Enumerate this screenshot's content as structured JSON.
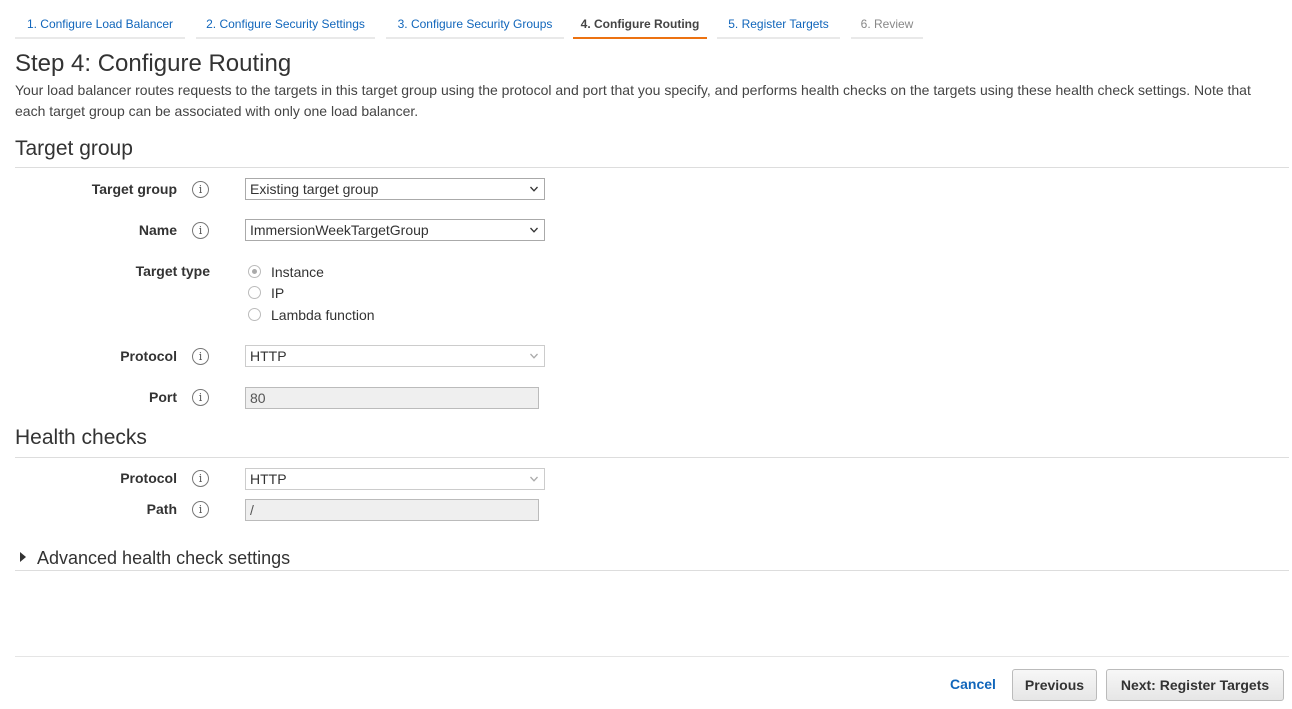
{
  "wizard": {
    "steps": [
      {
        "label": "1. Configure Load Balancer",
        "state": "done"
      },
      {
        "label": "2. Configure Security Settings",
        "state": "done"
      },
      {
        "label": "3. Configure Security Groups",
        "state": "done"
      },
      {
        "label": "4. Configure Routing",
        "state": "active"
      },
      {
        "label": "5. Register Targets",
        "state": "link"
      },
      {
        "label": "6. Review",
        "state": "disabled"
      }
    ],
    "accent_color": "#ec7211",
    "link_color": "#1166bb"
  },
  "page": {
    "title": "Step 4: Configure Routing",
    "description": "Your load balancer routes requests to the targets in this target group using the protocol and port that you specify, and performs health checks on the targets using these health check settings. Note that each target group can be associated with only one load balancer."
  },
  "target_group": {
    "heading": "Target group",
    "target_group_label": "Target group",
    "target_group_value": "Existing target group",
    "name_label": "Name",
    "name_value": "ImmersionWeekTargetGroup",
    "target_type_label": "Target type",
    "target_type_options": [
      "Instance",
      "IP",
      "Lambda function"
    ],
    "target_type_selected": "Instance",
    "protocol_label": "Protocol",
    "protocol_value": "HTTP",
    "port_label": "Port",
    "port_value": "80"
  },
  "health_checks": {
    "heading": "Health checks",
    "protocol_label": "Protocol",
    "protocol_value": "HTTP",
    "path_label": "Path",
    "path_value": "/",
    "advanced_label": "Advanced health check settings"
  },
  "icons": {
    "info": "info-icon",
    "dropdown": "chevron-down-icon",
    "expand": "caret-right-icon"
  },
  "info_glyph": "i",
  "footer": {
    "cancel_label": "Cancel",
    "previous_label": "Previous",
    "next_label": "Next: Register Targets"
  }
}
